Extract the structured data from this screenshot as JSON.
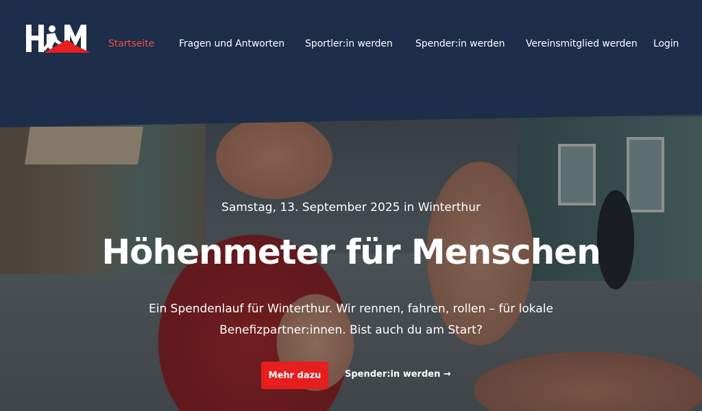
{
  "nav": {
    "logo_alt": "HFM",
    "items": [
      {
        "label": "Startseite",
        "active": true
      },
      {
        "label": "Fragen und Antworten",
        "active": false
      },
      {
        "label": "Sportler:in werden",
        "active": false
      },
      {
        "label": "Spender:in werden",
        "active": false
      },
      {
        "label": "Vereinsmitglied werden",
        "active": false
      },
      {
        "label": "Login",
        "active": false
      }
    ]
  },
  "hero": {
    "date": "Samstag, 13. September 2025 in Winterthur",
    "title": "Höhenmeter für Menschen",
    "description": "Ein Spendenlauf für Winterthur. Wir rennen, fahren, rollen – für lokale Benefizpartner:innen. Bist auch du am Start?",
    "primary_button": "Mehr dazu",
    "secondary_link": "Spender:in werden →"
  },
  "colors": {
    "header_bg": "#1c2e4a",
    "active_nav": "#f04d4d",
    "button_red": "#e61e1e",
    "text": "#ffffff"
  }
}
